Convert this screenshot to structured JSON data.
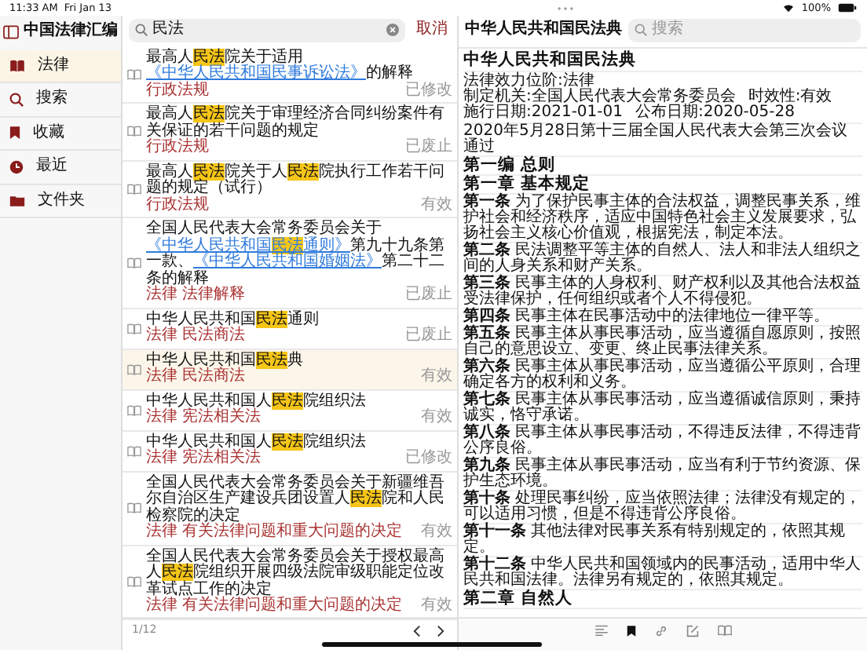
{
  "status_bar": {
    "time": "11:33 AM",
    "date": "Fri Jan 13",
    "battery": "100%"
  },
  "sidebar": {
    "title": "中国法律汇编",
    "items": [
      {
        "label": "法律",
        "selected": true
      },
      {
        "label": "搜索",
        "selected": false
      },
      {
        "label": "收藏",
        "selected": false
      },
      {
        "label": "最近",
        "selected": false
      },
      {
        "label": "文件夹",
        "selected": false
      }
    ]
  },
  "search": {
    "value": "民法",
    "cancel": "取消"
  },
  "results": [
    {
      "title": [
        {
          "text": "最高人",
          "kind": "plain"
        },
        {
          "text": "民法",
          "kind": "match"
        },
        {
          "text": "院关于适用",
          "kind": "plain"
        },
        {
          "text": "《中华人民共和国民事诉讼法》",
          "kind": "link"
        },
        {
          "text": "的解释",
          "kind": "plain"
        }
      ],
      "tags": "行政法规",
      "status": "已修改",
      "selected": false
    },
    {
      "title": [
        {
          "text": "最高人",
          "kind": "plain"
        },
        {
          "text": "民法",
          "kind": "match"
        },
        {
          "text": "院关于审理经济合同纠纷案件有关保证的若干问题的规定",
          "kind": "plain"
        }
      ],
      "tags": "行政法规",
      "status": "已废止",
      "selected": false
    },
    {
      "title": [
        {
          "text": "最高人",
          "kind": "plain"
        },
        {
          "text": "民法",
          "kind": "match"
        },
        {
          "text": "院关于人",
          "kind": "plain"
        },
        {
          "text": "民法",
          "kind": "match"
        },
        {
          "text": "院执行工作若干问题的规定（试行）",
          "kind": "plain"
        }
      ],
      "tags": "行政法规",
      "status": "有效",
      "selected": false
    },
    {
      "title": [
        {
          "text": "全国人民代表大会常务委员会关于",
          "kind": "plain"
        },
        {
          "text": "《中华人民共和国",
          "kind": "link"
        },
        {
          "text": "民法",
          "kind": "link_match"
        },
        {
          "text": "通则》",
          "kind": "link"
        },
        {
          "text": "第九十九条第一款、",
          "kind": "plain"
        },
        {
          "text": "《中华人民共和国婚姻法》",
          "kind": "link"
        },
        {
          "text": "第二十二条的解释",
          "kind": "plain"
        }
      ],
      "tags": "法律 法律解释",
      "status": "已废止",
      "selected": false
    },
    {
      "title": [
        {
          "text": "中华人民共和国",
          "kind": "plain"
        },
        {
          "text": "民法",
          "kind": "match"
        },
        {
          "text": "通则",
          "kind": "plain"
        }
      ],
      "tags": "法律 民法商法",
      "status": "已废止",
      "selected": false
    },
    {
      "title": [
        {
          "text": "中华人民共和国",
          "kind": "plain"
        },
        {
          "text": "民法",
          "kind": "match"
        },
        {
          "text": "典",
          "kind": "plain"
        }
      ],
      "tags": "法律 民法商法",
      "status": "有效",
      "selected": true
    },
    {
      "title": [
        {
          "text": "中华人民共和国人",
          "kind": "plain"
        },
        {
          "text": "民法",
          "kind": "match"
        },
        {
          "text": "院组织法",
          "kind": "plain"
        }
      ],
      "tags": "法律 宪法相关法",
      "status": "有效",
      "selected": false
    },
    {
      "title": [
        {
          "text": "中华人民共和国人",
          "kind": "plain"
        },
        {
          "text": "民法",
          "kind": "match"
        },
        {
          "text": "院组织法",
          "kind": "plain"
        }
      ],
      "tags": "法律 宪法相关法",
      "status": "已修改",
      "selected": false
    },
    {
      "title": [
        {
          "text": "全国人民代表大会常务委员会关于新疆维吾尔自治区生产建设兵团设置人",
          "kind": "plain"
        },
        {
          "text": "民法",
          "kind": "match"
        },
        {
          "text": "院和人民检察院的决定",
          "kind": "plain"
        }
      ],
      "tags": "法律 有关法律问题和重大问题的决定",
      "status": "有效",
      "selected": false
    },
    {
      "title": [
        {
          "text": "全国人民代表大会常务委员会关于授权最高人",
          "kind": "plain"
        },
        {
          "text": "民法",
          "kind": "match"
        },
        {
          "text": "院组织开展四级法院审级职能定位改革试点工作的决定",
          "kind": "plain"
        }
      ],
      "tags": "法律 有关法律问题和重大问题的决定",
      "status": "有效",
      "selected": false
    }
  ],
  "pagination": {
    "page": "1/12"
  },
  "document": {
    "header_title": "中华人民共和国民法典",
    "search_placeholder": "搜索",
    "title": "中华人民共和国民法典",
    "meta": [
      "法律效力位阶:法律",
      "制定机关:全国人民代表大会常务委员会",
      "时效性:有效",
      "施行日期:2021-01-01",
      "公布日期:2020-05-28"
    ],
    "adopted": "2020年5月28日第十三届全国人民代表大会第三次会议通过",
    "sections": [
      {
        "kind": "part",
        "text": "第一编 总则"
      },
      {
        "kind": "chapter",
        "text": "第一章 基本规定"
      },
      {
        "kind": "article",
        "number": "第一条",
        "text": "为了保护民事主体的合法权益，调整民事关系，维护社会和经济秩序，适应中国特色社会主义发展要求，弘扬社会主义核心价值观，根据宪法，制定本法。"
      },
      {
        "kind": "article",
        "number": "第二条",
        "text": "民法调整平等主体的自然人、法人和非法人组织之间的人身关系和财产关系。"
      },
      {
        "kind": "article",
        "number": "第三条",
        "text": "民事主体的人身权利、财产权利以及其他合法权益受法律保护，任何组织或者个人不得侵犯。"
      },
      {
        "kind": "article",
        "number": "第四条",
        "text": "民事主体在民事活动中的法律地位一律平等。"
      },
      {
        "kind": "article",
        "number": "第五条",
        "text": "民事主体从事民事活动，应当遵循自愿原则，按照自己的意思设立、变更、终止民事法律关系。"
      },
      {
        "kind": "article",
        "number": "第六条",
        "text": "民事主体从事民事活动，应当遵循公平原则，合理确定各方的权利和义务。"
      },
      {
        "kind": "article",
        "number": "第七条",
        "text": "民事主体从事民事活动，应当遵循诚信原则，秉持诚实，恪守承诺。"
      },
      {
        "kind": "article",
        "number": "第八条",
        "text": "民事主体从事民事活动，不得违反法律，不得违背公序良俗。"
      },
      {
        "kind": "article",
        "number": "第九条",
        "text": "民事主体从事民事活动，应当有利于节约资源、保护生态环境。"
      },
      {
        "kind": "article",
        "number": "第十条",
        "text": "处理民事纠纷，应当依照法律；法律没有规定的，可以适用习惯，但是不得违背公序良俗。"
      },
      {
        "kind": "article",
        "number": "第十一条",
        "text": "其他法律对民事关系有特别规定的，依照其规定。"
      },
      {
        "kind": "article",
        "number": "第十二条",
        "text": "中华人民共和国领域内的民事活动，适用中华人民共和国法律。法律另有规定的，依照其规定。"
      },
      {
        "kind": "chapter",
        "text": "第二章 自然人"
      }
    ]
  }
}
